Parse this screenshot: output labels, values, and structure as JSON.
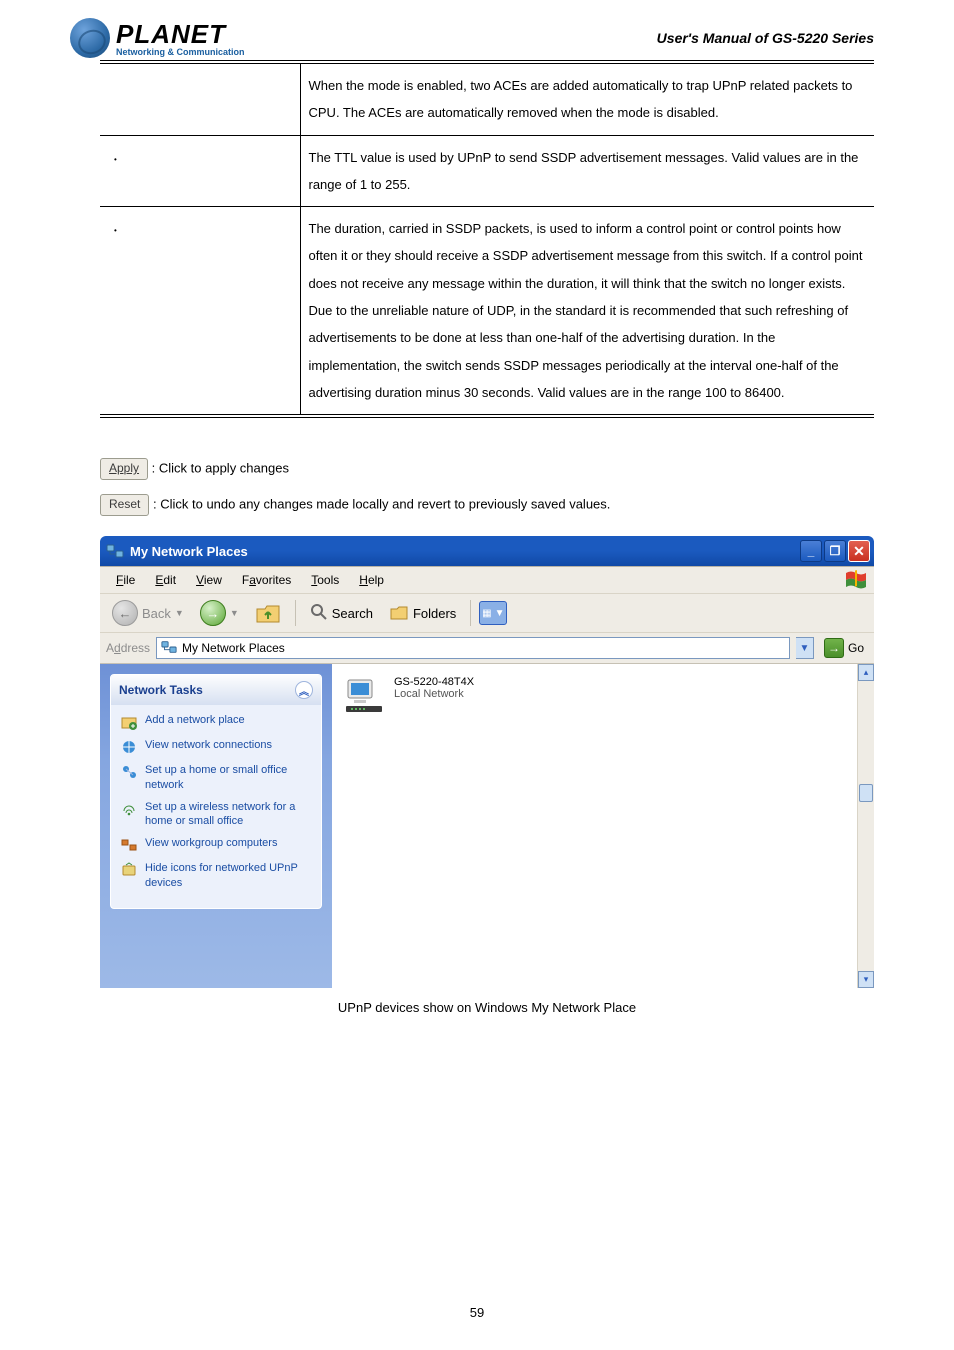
{
  "header": {
    "brand": "PLANET",
    "tagline": "Networking & Communication",
    "manual_title": "User's Manual of GS-5220 Series"
  },
  "table": {
    "row0": {
      "col1": "",
      "col2": "When the mode is enabled, two ACEs are added automatically to trap UPnP related packets to CPU. The ACEs are automatically removed when the mode is disabled."
    },
    "row1": {
      "bullet": "•",
      "col1": "",
      "col2": "The TTL value is used by UPnP to send SSDP advertisement messages. Valid values are in the range of 1 to 255."
    },
    "row2": {
      "bullet": "•",
      "col1": "",
      "col2": "The duration, carried in SSDP packets, is used to inform a control point or control points how often it or they should receive a SSDP advertisement message from this switch. If a control point does not receive any message within the duration, it will think that the switch no longer exists. Due to the unreliable nature of UDP, in the standard it is recommended that such refreshing of advertisements to be done at less than one-half of the advertising duration. In the implementation, the switch sends SSDP messages periodically at the interval one-half of the advertising duration minus 30 seconds. Valid values are in the range 100 to 86400."
    }
  },
  "buttons": {
    "apply": "Apply",
    "apply_desc": ": Click to apply changes",
    "reset": "Reset",
    "reset_desc": ": Click to undo any changes made locally and revert to previously saved values."
  },
  "explorer": {
    "title": "My Network Places",
    "menu": {
      "file": "File",
      "file_u": "F",
      "edit": "Edit",
      "edit_u": "E",
      "view": "View",
      "view_u": "V",
      "favorites": "Favorites",
      "favorites_u": "a",
      "tools": "Tools",
      "tools_u": "T",
      "help": "Help",
      "help_u": "H"
    },
    "toolbar": {
      "back": "Back",
      "search": "Search",
      "folders": "Folders"
    },
    "address": {
      "label": "Address",
      "value": "My Network Places",
      "address_u": "d",
      "go": "Go"
    },
    "tasks": {
      "heading": "Network Tasks",
      "items": [
        "Add a network place",
        "View network connections",
        "Set up a home or small office network",
        "Set up a wireless network for a home or small office",
        "View workgroup computers",
        "Hide icons for networked UPnP devices"
      ]
    },
    "device": {
      "name": "GS-5220-48T4X",
      "sub": "Local Network"
    }
  },
  "caption": "UPnP devices show on Windows My Network Place",
  "page_number": "59"
}
